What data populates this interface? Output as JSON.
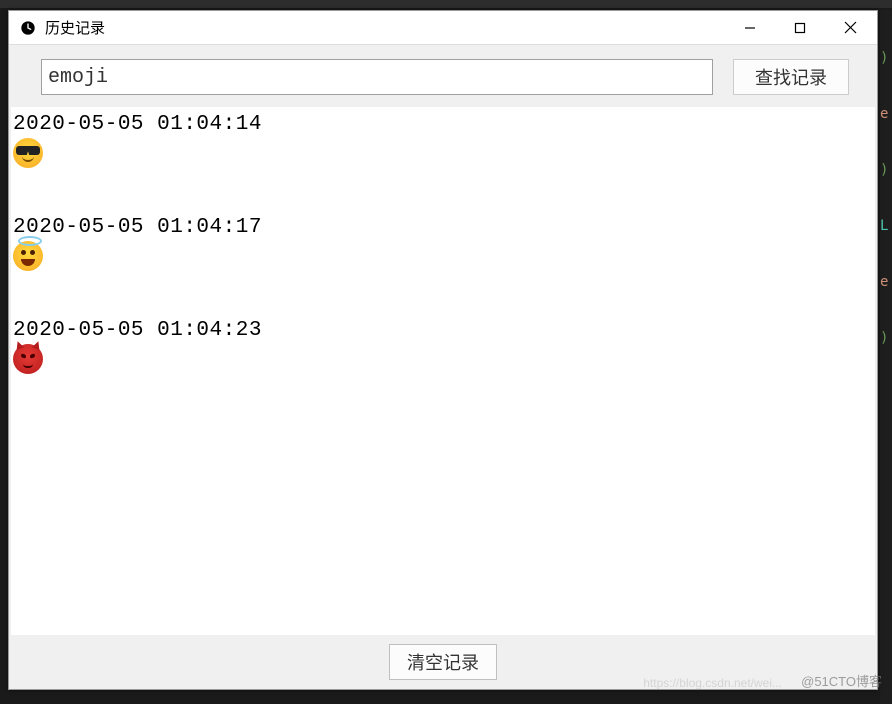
{
  "window": {
    "title": "历史记录"
  },
  "search": {
    "value": "emoji",
    "button_label": "查找记录"
  },
  "history": {
    "entries": [
      {
        "timestamp": "2020-05-05 01:04:14",
        "emoji": "cool"
      },
      {
        "timestamp": "2020-05-05 01:04:17",
        "emoji": "angel"
      },
      {
        "timestamp": "2020-05-05 01:04:23",
        "emoji": "devil"
      }
    ]
  },
  "footer": {
    "clear_label": "清空记录"
  },
  "watermark": {
    "text": "@51CTO博客",
    "url": "https://blog.csdn.net/wei..."
  }
}
